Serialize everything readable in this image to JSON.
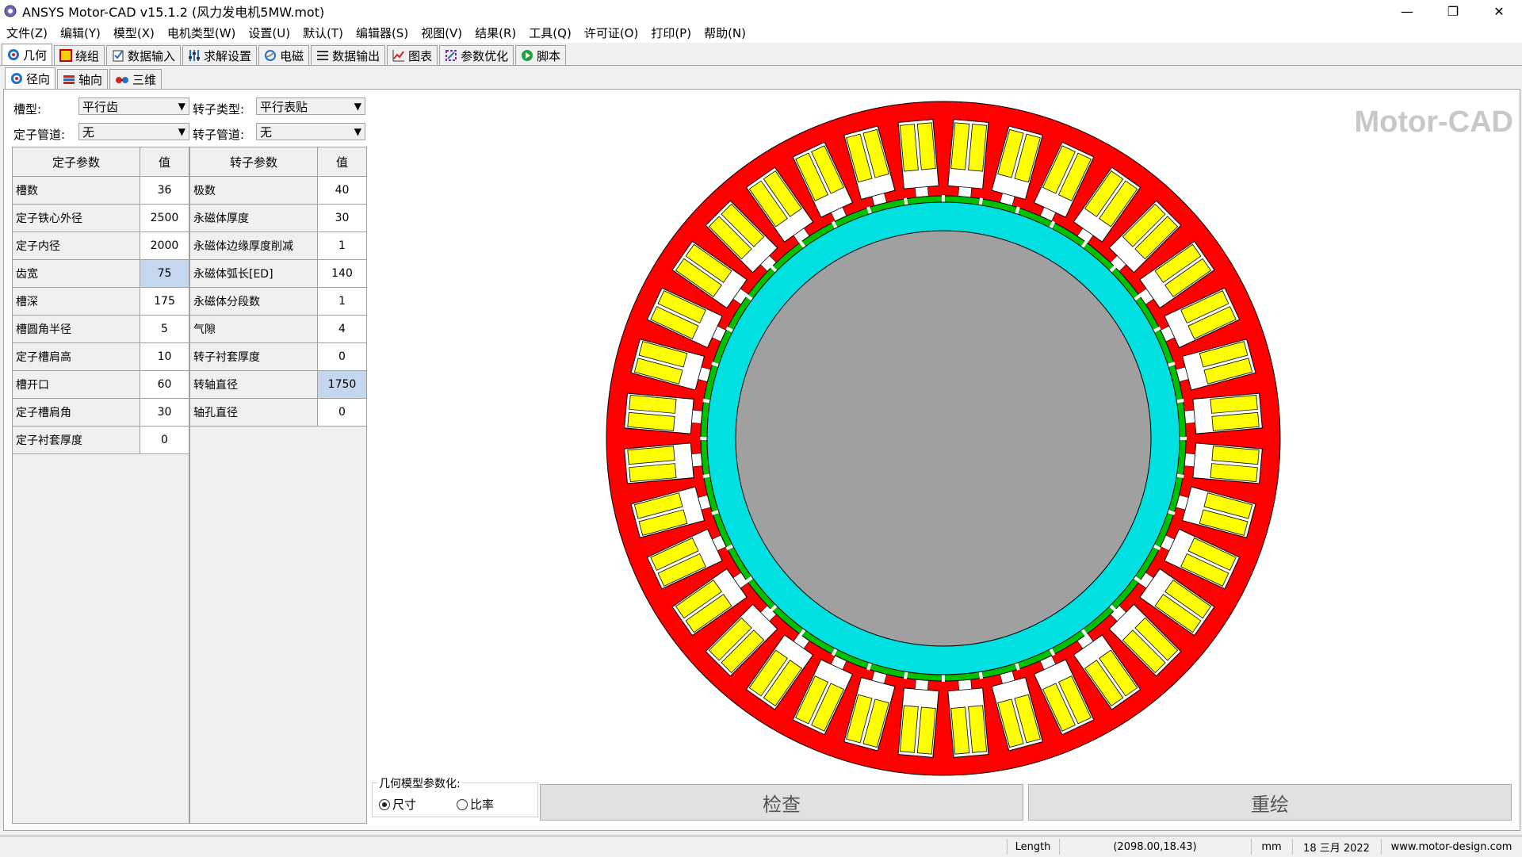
{
  "window": {
    "title": "ANSYS Motor-CAD v15.1.2 (风力发电机5MW.mot)",
    "minimize": "—",
    "restore": "❐",
    "close": "✕"
  },
  "menu": [
    "文件(Z)",
    "编辑(Y)",
    "模型(X)",
    "电机类型(W)",
    "设置(U)",
    "默认(T)",
    "编辑器(S)",
    "视图(V)",
    "结果(R)",
    "工具(Q)",
    "许可证(O)",
    "打印(P)",
    "帮助(N)"
  ],
  "tabs": [
    "几何",
    "绕组",
    "数据输入",
    "求解设置",
    "电磁",
    "数据输出",
    "图表",
    "参数优化",
    "脚本"
  ],
  "subtabs": [
    "径向",
    "轴向",
    "三维"
  ],
  "selectors": {
    "slot_type_label": "槽型:",
    "slot_type_value": "平行齿",
    "rotor_type_label": "转子类型:",
    "rotor_type_value": "平行表贴",
    "stator_duct_label": "定子管道:",
    "stator_duct_value": "无",
    "rotor_duct_label": "转子管道:",
    "rotor_duct_value": "无"
  },
  "stator_table": {
    "header_name": "定子参数",
    "header_value": "值",
    "rows": [
      {
        "name": "槽数",
        "value": "36"
      },
      {
        "name": "定子铁心外径",
        "value": "2500"
      },
      {
        "name": "定子内径",
        "value": "2000"
      },
      {
        "name": "齿宽",
        "value": "75"
      },
      {
        "name": "槽深",
        "value": "175"
      },
      {
        "name": "槽圆角半径",
        "value": "5"
      },
      {
        "name": "定子槽肩高",
        "value": "10"
      },
      {
        "name": "槽开口",
        "value": "60"
      },
      {
        "name": "定子槽肩角",
        "value": "30"
      },
      {
        "name": "定子衬套厚度",
        "value": "0"
      }
    ]
  },
  "rotor_table": {
    "header_name": "转子参数",
    "header_value": "值",
    "rows": [
      {
        "name": "极数",
        "value": "40"
      },
      {
        "name": "永磁体厚度",
        "value": "30"
      },
      {
        "name": "永磁体边缘厚度削减",
        "value": "1"
      },
      {
        "name": "永磁体弧长[ED]",
        "value": "140"
      },
      {
        "name": "永磁体分段数",
        "value": "1"
      },
      {
        "name": "气隙",
        "value": "4"
      },
      {
        "name": "转子衬套厚度",
        "value": "0"
      },
      {
        "name": "转轴直径",
        "value": "1750"
      },
      {
        "name": "轴孔直径",
        "value": "0"
      }
    ]
  },
  "logo_text": "Motor-CAD",
  "param_group": {
    "legend": "几何模型参数化:",
    "option_size": "尺寸",
    "option_ratio": "比率"
  },
  "buttons": {
    "check": "检查",
    "redraw": "重绘"
  },
  "status": {
    "measure": "Length",
    "coords": "(2098.00,18.43)",
    "unit": "mm",
    "date": "18 三月 2022",
    "website": "www.motor-design.com"
  },
  "colors": {
    "stator": "#ff0000",
    "winding": "#ffff00",
    "magnet": "#00c000",
    "rotor": "#00e0e0",
    "shaft": "#a0a0a0",
    "selected_cell": "#c5d7ef"
  },
  "geometry": {
    "slots": 36,
    "poles": 40
  }
}
